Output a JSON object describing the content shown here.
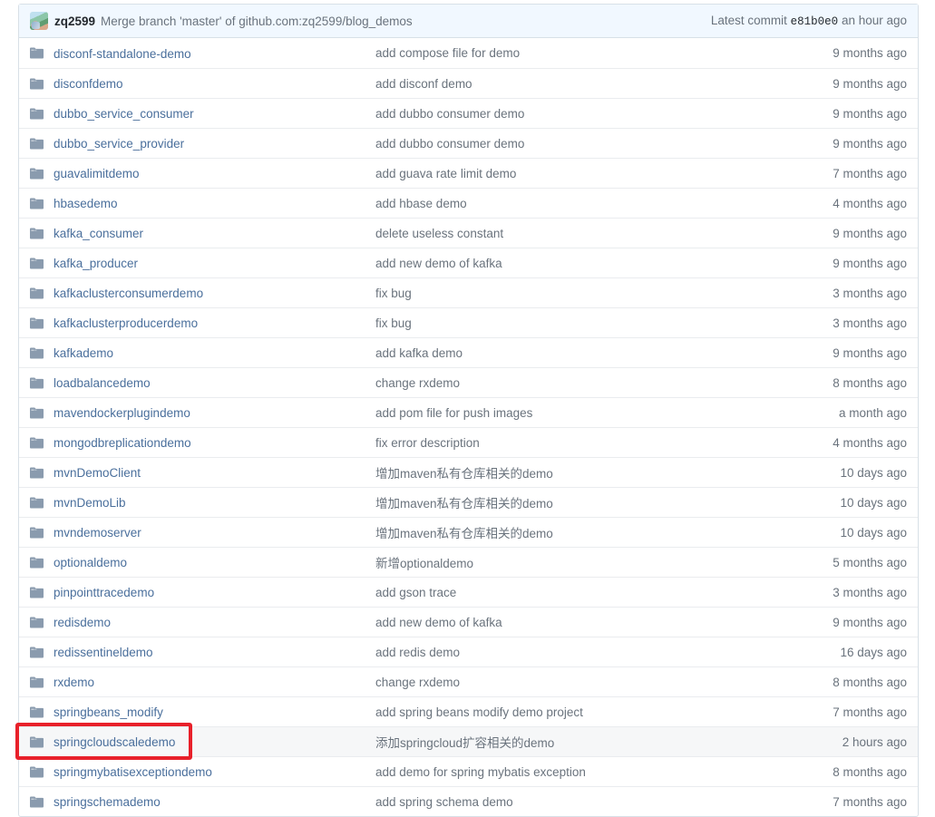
{
  "header": {
    "author": "zq2599",
    "commit_message": "Merge branch 'master' of github.com:zq2599/blog_demos",
    "latest_commit_label": "Latest commit",
    "commit_sha": "e81b0e0",
    "commit_age": "an hour ago",
    "avatar_name": "user-avatar",
    "background_color": "#f1f8ff"
  },
  "colors": {
    "link": "#4a6f9c",
    "muted": "#6a737d",
    "border": "#eaecef",
    "annotation": "#e8202a",
    "folder_icon": "#8a9bae"
  },
  "annotation": {
    "target_row_name": "springcloudscaledemo",
    "color": "#e8202a"
  },
  "files": [
    {
      "icon": "folder-icon",
      "name": "disconf-standalone-demo",
      "message": "add compose file for demo",
      "age": "9 months ago",
      "highlighted": false
    },
    {
      "icon": "folder-icon",
      "name": "disconfdemo",
      "message": "add disconf demo",
      "age": "9 months ago",
      "highlighted": false
    },
    {
      "icon": "folder-icon",
      "name": "dubbo_service_consumer",
      "message": "add dubbo consumer demo",
      "age": "9 months ago",
      "highlighted": false
    },
    {
      "icon": "folder-icon",
      "name": "dubbo_service_provider",
      "message": "add dubbo consumer demo",
      "age": "9 months ago",
      "highlighted": false
    },
    {
      "icon": "folder-icon",
      "name": "guavalimitdemo",
      "message": "add guava rate limit demo",
      "age": "7 months ago",
      "highlighted": false
    },
    {
      "icon": "folder-icon",
      "name": "hbasedemo",
      "message": "add hbase demo",
      "age": "4 months ago",
      "highlighted": false
    },
    {
      "icon": "folder-icon",
      "name": "kafka_consumer",
      "message": "delete useless constant",
      "age": "9 months ago",
      "highlighted": false
    },
    {
      "icon": "folder-icon",
      "name": "kafka_producer",
      "message": "add new demo of kafka",
      "age": "9 months ago",
      "highlighted": false
    },
    {
      "icon": "folder-icon",
      "name": "kafkaclusterconsumerdemo",
      "message": "fix bug",
      "age": "3 months ago",
      "highlighted": false
    },
    {
      "icon": "folder-icon",
      "name": "kafkaclusterproducerdemo",
      "message": "fix bug",
      "age": "3 months ago",
      "highlighted": false
    },
    {
      "icon": "folder-icon",
      "name": "kafkademo",
      "message": "add kafka demo",
      "age": "9 months ago",
      "highlighted": false
    },
    {
      "icon": "folder-icon",
      "name": "loadbalancedemo",
      "message": "change rxdemo",
      "age": "8 months ago",
      "highlighted": false
    },
    {
      "icon": "folder-icon",
      "name": "mavendockerplugindemo",
      "message": "add pom file for push images",
      "age": "a month ago",
      "highlighted": false
    },
    {
      "icon": "folder-icon",
      "name": "mongodbreplicationdemo",
      "message": "fix error description",
      "age": "4 months ago",
      "highlighted": false
    },
    {
      "icon": "folder-icon",
      "name": "mvnDemoClient",
      "message": "增加maven私有仓库相关的demo",
      "age": "10 days ago",
      "highlighted": false
    },
    {
      "icon": "folder-icon",
      "name": "mvnDemoLib",
      "message": "增加maven私有仓库相关的demo",
      "age": "10 days ago",
      "highlighted": false
    },
    {
      "icon": "folder-icon",
      "name": "mvndemoserver",
      "message": "增加maven私有仓库相关的demo",
      "age": "10 days ago",
      "highlighted": false
    },
    {
      "icon": "folder-icon",
      "name": "optionaldemo",
      "message": "新增optionaldemo",
      "age": "5 months ago",
      "highlighted": false
    },
    {
      "icon": "folder-icon",
      "name": "pinpointtracedemo",
      "message": "add gson trace",
      "age": "3 months ago",
      "highlighted": false
    },
    {
      "icon": "folder-icon",
      "name": "redisdemo",
      "message": "add new demo of kafka",
      "age": "9 months ago",
      "highlighted": false
    },
    {
      "icon": "folder-icon",
      "name": "redissentineldemo",
      "message": "add redis demo",
      "age": "16 days ago",
      "highlighted": false
    },
    {
      "icon": "folder-icon",
      "name": "rxdemo",
      "message": "change rxdemo",
      "age": "8 months ago",
      "highlighted": false
    },
    {
      "icon": "folder-icon",
      "name": "springbeans_modify",
      "message": "add spring beans modify demo project",
      "age": "7 months ago",
      "highlighted": false
    },
    {
      "icon": "folder-icon",
      "name": "springcloudscaledemo",
      "message": "添加springcloud扩容相关的demo",
      "age": "2 hours ago",
      "highlighted": true
    },
    {
      "icon": "folder-icon",
      "name": "springmybatisexceptiondemo",
      "message": "add demo for spring mybatis exception",
      "age": "8 months ago",
      "highlighted": false
    },
    {
      "icon": "folder-icon",
      "name": "springschemademo",
      "message": "add spring schema demo",
      "age": "7 months ago",
      "highlighted": false
    }
  ]
}
